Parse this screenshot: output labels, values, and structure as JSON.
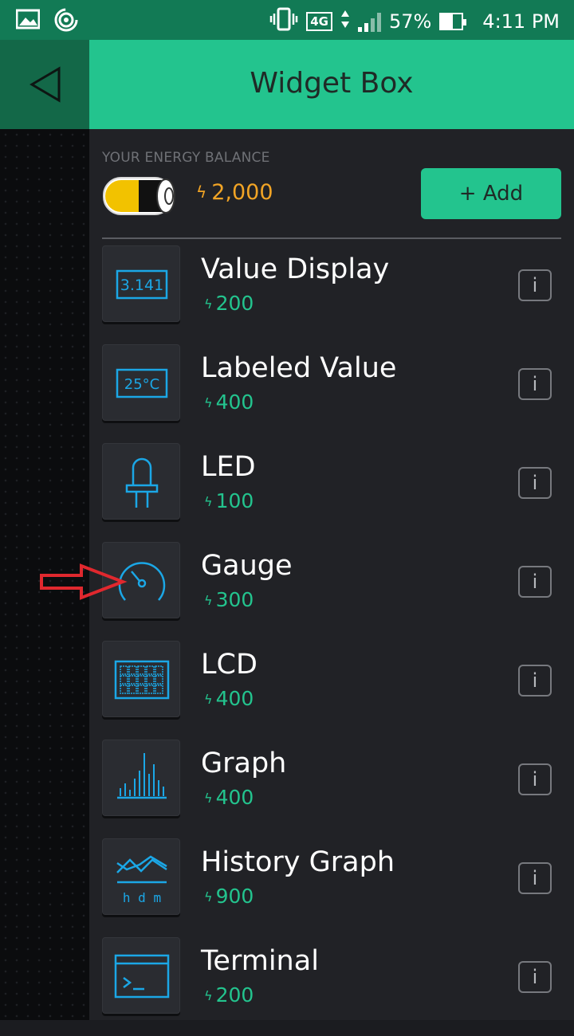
{
  "status_bar": {
    "battery_percent": "57%",
    "time": "4:11 PM",
    "network": "4G",
    "battery_level": 0.57
  },
  "header": {
    "title": "Widget Box"
  },
  "energy": {
    "label": "YOUR ENERGY BALANCE",
    "value": "2,000",
    "bolt": "ϟ",
    "add_label": "+ Add",
    "value_color": "#f1a425"
  },
  "colors": {
    "accent": "#23c48e",
    "icon_blue": "#1ba7e6",
    "arrow_red": "#e0282e"
  },
  "widgets": [
    {
      "name": "Value Display",
      "cost": "200",
      "icon": "value-display-icon",
      "icon_text": "3.141"
    },
    {
      "name": "Labeled Value",
      "cost": "400",
      "icon": "labeled-value-icon",
      "icon_text": "25°C"
    },
    {
      "name": "LED",
      "cost": "100",
      "icon": "led-icon"
    },
    {
      "name": "Gauge",
      "cost": "300",
      "icon": "gauge-icon"
    },
    {
      "name": "LCD",
      "cost": "400",
      "icon": "lcd-icon"
    },
    {
      "name": "Graph",
      "cost": "400",
      "icon": "graph-icon"
    },
    {
      "name": "History Graph",
      "cost": "900",
      "icon": "history-graph-icon",
      "icon_text": "h d m"
    },
    {
      "name": "Terminal",
      "cost": "200",
      "icon": "terminal-icon"
    }
  ],
  "info_label": "i"
}
